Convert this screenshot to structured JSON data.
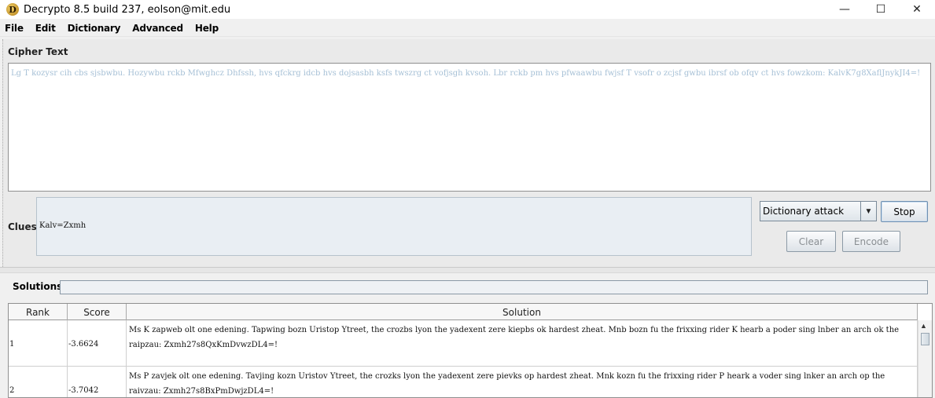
{
  "window": {
    "title": "Decrypto 8.5 build 237, eolson@mit.edu",
    "app_icon_letter": "D",
    "controls": {
      "minimize": "—",
      "maximize": "☐",
      "close": "✕"
    }
  },
  "menu": [
    "File",
    "Edit",
    "Dictionary",
    "Advanced",
    "Help"
  ],
  "cipher": {
    "label": "Cipher Text",
    "text": "Lg T kozysr cih cbs sjsbwbu. Hozywbu rckb Mfwghcz Dhfssh, hvs qfckrg idcb hvs dojsasbh ksfs twszrg ct vofjsgh kvsoh. Lbr rckb pm hvs pfwaawbu fwjsf T vsofr o zcjsf gwbu ibrsf ob ofqv ct hvs fowzkom: KalvK7g8XaflJnykJI4=!"
  },
  "clues": {
    "label": "Clues",
    "text": "Kalv=Zxmh"
  },
  "controls": {
    "attack_type": "Dictionary attack",
    "stop": "Stop",
    "clear": "Clear",
    "encode": "Encode"
  },
  "solutions": {
    "label": "Solutions:",
    "columns": [
      "Rank",
      "Score",
      "Solution"
    ],
    "rows": [
      {
        "rank": "1",
        "score": "-3.6624",
        "solution": "Ms K zapweb olt one edening. Tapwing bozn Uristop Ytreet, the crozbs lyon the yadexent zere kiepbs ok hardest zheat. Mnb bozn fu the frixxing rider K hearb a poder sing lnber an arch ok the raipzau: Zxmh27s8QxKmDvwzDL4=!"
      },
      {
        "rank": "2",
        "score": "-3.7042",
        "solution": "Ms P zavjek olt one edening. Tavjing kozn Uristov Ytreet, the crozks lyon the yadexent zere pievks op hardest zheat. Mnk kozn fu the frixxing rider P heark a voder sing lnker an arch op the raivzau: Zxmh27s8BxPmDwjzDL4=!"
      }
    ]
  }
}
